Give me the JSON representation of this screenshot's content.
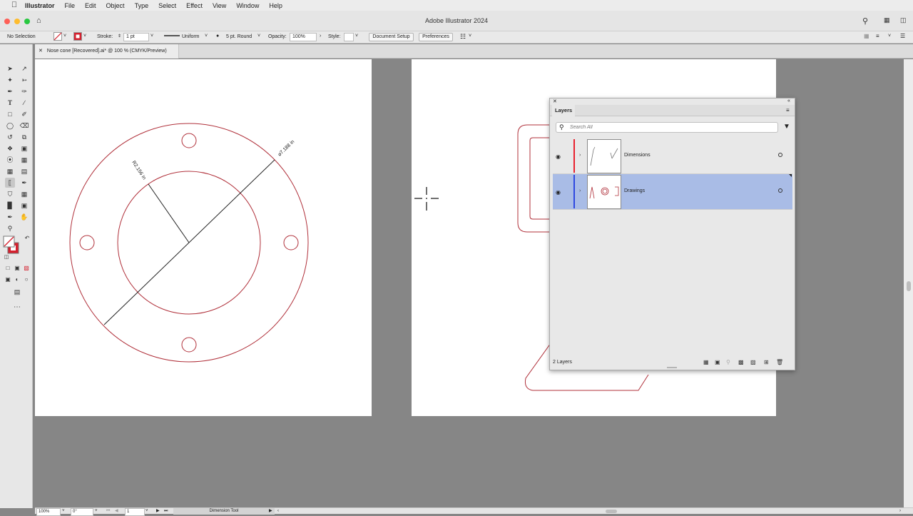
{
  "menubar": {
    "app_name": "Illustrator",
    "items": [
      "File",
      "Edit",
      "Object",
      "Type",
      "Select",
      "Effect",
      "View",
      "Window",
      "Help"
    ]
  },
  "window": {
    "title": "Adobe Illustrator 2024"
  },
  "control_bar": {
    "selection": "No Selection",
    "stroke_label": "Stroke:",
    "stroke_weight": "1 pt",
    "profile": "Uniform",
    "brush": "5 pt. Round",
    "opacity_label": "Opacity:",
    "opacity_value": "100%",
    "style_label": "Style:",
    "document_setup": "Document Setup",
    "preferences": "Preferences"
  },
  "document_tab": {
    "title": "Nose cone [Recovered].ai* @ 100 % (CMYK/Preview)"
  },
  "drawing": {
    "line_color": "#b0303a",
    "radius_label": "R2.156 in",
    "diameter_label": "⌀7.188 in"
  },
  "layers_panel": {
    "tab": "Layers",
    "search_placeholder": "Search All",
    "layers": [
      {
        "name": "Dimensions",
        "color": "#e8212e",
        "selected": false
      },
      {
        "name": "Drawings",
        "color": "#2e48e0",
        "selected": true
      }
    ],
    "count": "2 Layers",
    "selected_bg": "#a9bce6"
  },
  "status_bar": {
    "zoom": "100%",
    "rotation": "0°",
    "artboard": "1",
    "tool": "Dimension Tool"
  }
}
